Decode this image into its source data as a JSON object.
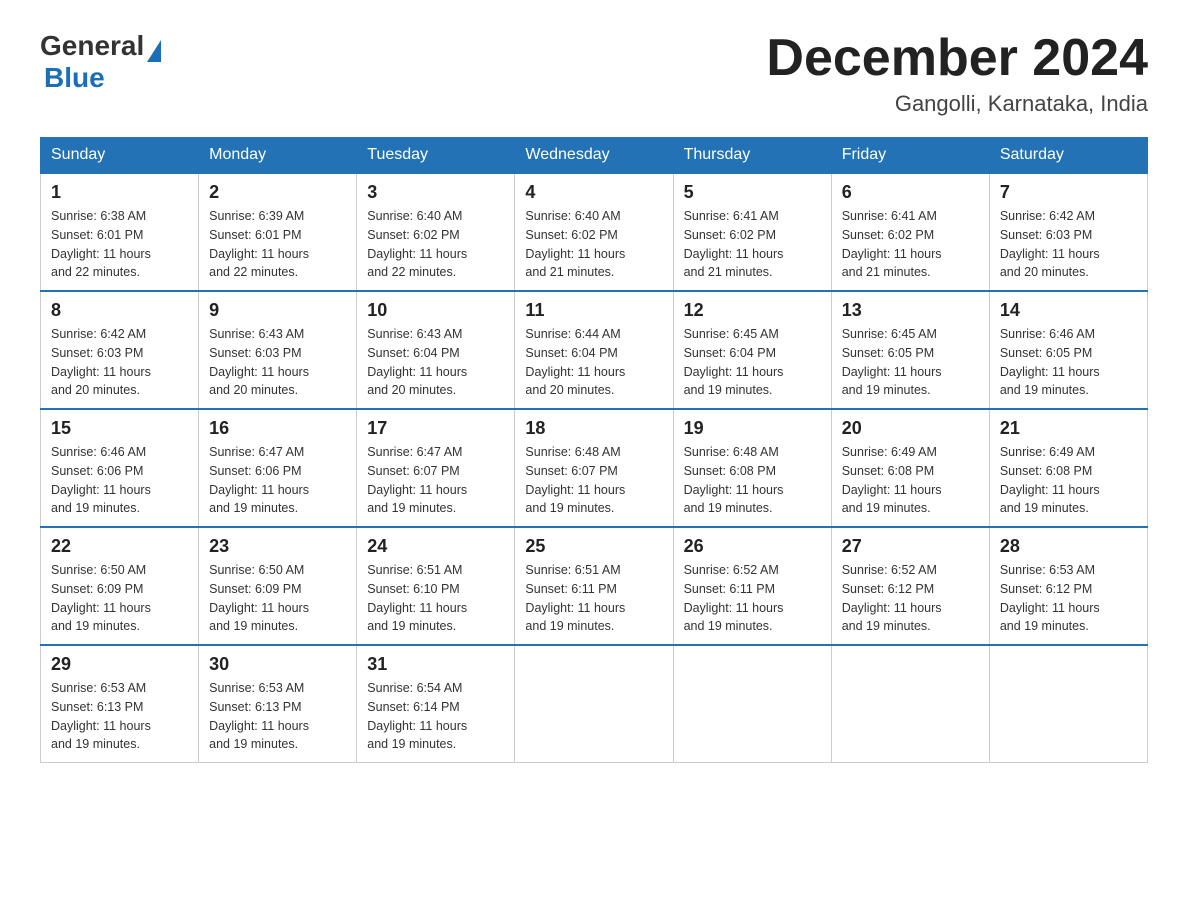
{
  "logo": {
    "general": "General",
    "blue": "Blue"
  },
  "title": "December 2024",
  "location": "Gangolli, Karnataka, India",
  "days_of_week": [
    "Sunday",
    "Monday",
    "Tuesday",
    "Wednesday",
    "Thursday",
    "Friday",
    "Saturday"
  ],
  "weeks": [
    [
      {
        "day": "1",
        "sunrise": "6:38 AM",
        "sunset": "6:01 PM",
        "daylight": "11 hours and 22 minutes."
      },
      {
        "day": "2",
        "sunrise": "6:39 AM",
        "sunset": "6:01 PM",
        "daylight": "11 hours and 22 minutes."
      },
      {
        "day": "3",
        "sunrise": "6:40 AM",
        "sunset": "6:02 PM",
        "daylight": "11 hours and 22 minutes."
      },
      {
        "day": "4",
        "sunrise": "6:40 AM",
        "sunset": "6:02 PM",
        "daylight": "11 hours and 21 minutes."
      },
      {
        "day": "5",
        "sunrise": "6:41 AM",
        "sunset": "6:02 PM",
        "daylight": "11 hours and 21 minutes."
      },
      {
        "day": "6",
        "sunrise": "6:41 AM",
        "sunset": "6:02 PM",
        "daylight": "11 hours and 21 minutes."
      },
      {
        "day": "7",
        "sunrise": "6:42 AM",
        "sunset": "6:03 PM",
        "daylight": "11 hours and 20 minutes."
      }
    ],
    [
      {
        "day": "8",
        "sunrise": "6:42 AM",
        "sunset": "6:03 PM",
        "daylight": "11 hours and 20 minutes."
      },
      {
        "day": "9",
        "sunrise": "6:43 AM",
        "sunset": "6:03 PM",
        "daylight": "11 hours and 20 minutes."
      },
      {
        "day": "10",
        "sunrise": "6:43 AM",
        "sunset": "6:04 PM",
        "daylight": "11 hours and 20 minutes."
      },
      {
        "day": "11",
        "sunrise": "6:44 AM",
        "sunset": "6:04 PM",
        "daylight": "11 hours and 20 minutes."
      },
      {
        "day": "12",
        "sunrise": "6:45 AM",
        "sunset": "6:04 PM",
        "daylight": "11 hours and 19 minutes."
      },
      {
        "day": "13",
        "sunrise": "6:45 AM",
        "sunset": "6:05 PM",
        "daylight": "11 hours and 19 minutes."
      },
      {
        "day": "14",
        "sunrise": "6:46 AM",
        "sunset": "6:05 PM",
        "daylight": "11 hours and 19 minutes."
      }
    ],
    [
      {
        "day": "15",
        "sunrise": "6:46 AM",
        "sunset": "6:06 PM",
        "daylight": "11 hours and 19 minutes."
      },
      {
        "day": "16",
        "sunrise": "6:47 AM",
        "sunset": "6:06 PM",
        "daylight": "11 hours and 19 minutes."
      },
      {
        "day": "17",
        "sunrise": "6:47 AM",
        "sunset": "6:07 PM",
        "daylight": "11 hours and 19 minutes."
      },
      {
        "day": "18",
        "sunrise": "6:48 AM",
        "sunset": "6:07 PM",
        "daylight": "11 hours and 19 minutes."
      },
      {
        "day": "19",
        "sunrise": "6:48 AM",
        "sunset": "6:08 PM",
        "daylight": "11 hours and 19 minutes."
      },
      {
        "day": "20",
        "sunrise": "6:49 AM",
        "sunset": "6:08 PM",
        "daylight": "11 hours and 19 minutes."
      },
      {
        "day": "21",
        "sunrise": "6:49 AM",
        "sunset": "6:08 PM",
        "daylight": "11 hours and 19 minutes."
      }
    ],
    [
      {
        "day": "22",
        "sunrise": "6:50 AM",
        "sunset": "6:09 PM",
        "daylight": "11 hours and 19 minutes."
      },
      {
        "day": "23",
        "sunrise": "6:50 AM",
        "sunset": "6:09 PM",
        "daylight": "11 hours and 19 minutes."
      },
      {
        "day": "24",
        "sunrise": "6:51 AM",
        "sunset": "6:10 PM",
        "daylight": "11 hours and 19 minutes."
      },
      {
        "day": "25",
        "sunrise": "6:51 AM",
        "sunset": "6:11 PM",
        "daylight": "11 hours and 19 minutes."
      },
      {
        "day": "26",
        "sunrise": "6:52 AM",
        "sunset": "6:11 PM",
        "daylight": "11 hours and 19 minutes."
      },
      {
        "day": "27",
        "sunrise": "6:52 AM",
        "sunset": "6:12 PM",
        "daylight": "11 hours and 19 minutes."
      },
      {
        "day": "28",
        "sunrise": "6:53 AM",
        "sunset": "6:12 PM",
        "daylight": "11 hours and 19 minutes."
      }
    ],
    [
      {
        "day": "29",
        "sunrise": "6:53 AM",
        "sunset": "6:13 PM",
        "daylight": "11 hours and 19 minutes."
      },
      {
        "day": "30",
        "sunrise": "6:53 AM",
        "sunset": "6:13 PM",
        "daylight": "11 hours and 19 minutes."
      },
      {
        "day": "31",
        "sunrise": "6:54 AM",
        "sunset": "6:14 PM",
        "daylight": "11 hours and 19 minutes."
      },
      null,
      null,
      null,
      null
    ]
  ],
  "labels": {
    "sunrise": "Sunrise:",
    "sunset": "Sunset:",
    "daylight": "Daylight:"
  }
}
